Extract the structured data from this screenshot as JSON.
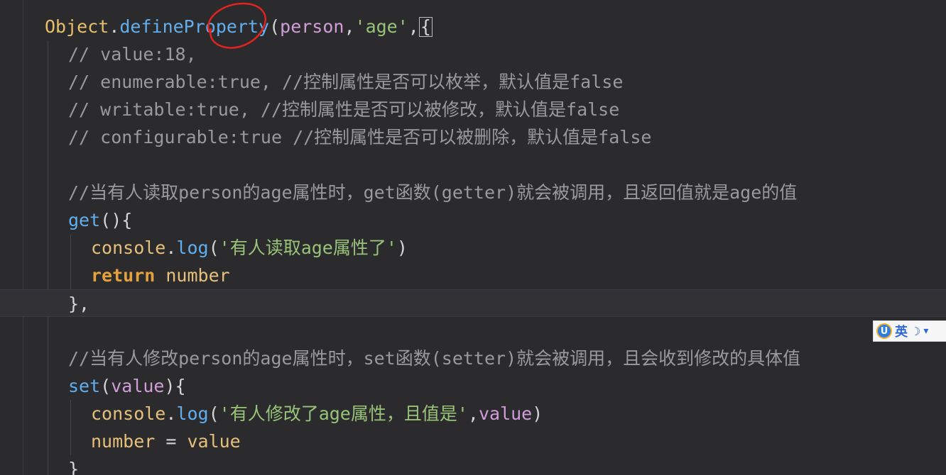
{
  "editor": {
    "lines": [
      {
        "id": "line-define-property",
        "tokens": [
          {
            "cls": "t-obj",
            "text": "Object"
          },
          {
            "cls": "t-punc",
            "text": "."
          },
          {
            "cls": "t-fn",
            "text": "defineProperty"
          },
          {
            "cls": "t-punc",
            "text": "("
          },
          {
            "cls": "t-param",
            "text": "person"
          },
          {
            "cls": "t-punc",
            "text": ","
          },
          {
            "cls": "t-str",
            "text": "'age'"
          },
          {
            "cls": "t-punc",
            "text": ","
          },
          {
            "cls": "t-punc",
            "text": "{",
            "boxed": true
          }
        ]
      },
      {
        "id": "line-comment-value",
        "tokens": [
          {
            "cls": "t-cmt",
            "text": "// value:18,"
          }
        ]
      },
      {
        "id": "line-comment-enumerable",
        "tokens": [
          {
            "cls": "t-cmt",
            "text": "// enumerable:true, //控制属性是否可以枚举，默认值是false"
          }
        ]
      },
      {
        "id": "line-comment-writable",
        "tokens": [
          {
            "cls": "t-cmt",
            "text": "// writable:true, //控制属性是否可以被修改，默认值是false"
          }
        ]
      },
      {
        "id": "line-comment-configurable",
        "tokens": [
          {
            "cls": "t-cmt",
            "text": "// configurable:true //控制属性是否可以被删除，默认值是false"
          }
        ]
      },
      {
        "id": "line-blank-1",
        "tokens": []
      },
      {
        "id": "line-comment-getter",
        "tokens": [
          {
            "cls": "t-cmt",
            "text": "//当有人读取person的age属性时，get函数(getter)就会被调用，且返回值就是age的值"
          }
        ]
      },
      {
        "id": "line-get-decl",
        "tokens": [
          {
            "cls": "t-fn",
            "text": "get"
          },
          {
            "cls": "t-punc",
            "text": "(){"
          }
        ]
      },
      {
        "id": "line-get-log",
        "tokens": [
          {
            "cls": "t-gold",
            "text": "console"
          },
          {
            "cls": "t-punc",
            "text": "."
          },
          {
            "cls": "t-call",
            "text": "log"
          },
          {
            "cls": "t-punc",
            "text": "("
          },
          {
            "cls": "t-str",
            "text": "'有人读取age属性了'"
          },
          {
            "cls": "t-punc",
            "text": ")"
          }
        ]
      },
      {
        "id": "line-get-return",
        "tokens": [
          {
            "cls": "t-kw",
            "text": "return"
          },
          {
            "cls": "t-punc",
            "text": " "
          },
          {
            "cls": "t-var",
            "text": "number"
          }
        ]
      },
      {
        "id": "line-get-close",
        "tokens": [
          {
            "cls": "t-punc",
            "text": "},"
          }
        ]
      },
      {
        "id": "line-blank-2",
        "tokens": []
      },
      {
        "id": "line-comment-setter",
        "tokens": [
          {
            "cls": "t-cmt",
            "text": "//当有人修改person的age属性时，set函数(setter)就会被调用，且会收到修改的具体值"
          }
        ]
      },
      {
        "id": "line-set-decl",
        "tokens": [
          {
            "cls": "t-fn",
            "text": "set"
          },
          {
            "cls": "t-punc",
            "text": "("
          },
          {
            "cls": "t-param",
            "text": "value"
          },
          {
            "cls": "t-punc",
            "text": "){"
          }
        ]
      },
      {
        "id": "line-set-log",
        "tokens": [
          {
            "cls": "t-gold",
            "text": "console"
          },
          {
            "cls": "t-punc",
            "text": "."
          },
          {
            "cls": "t-call",
            "text": "log"
          },
          {
            "cls": "t-punc",
            "text": "("
          },
          {
            "cls": "t-str",
            "text": "'有人修改了age属性，且值是'"
          },
          {
            "cls": "t-punc",
            "text": ","
          },
          {
            "cls": "t-param",
            "text": "value"
          },
          {
            "cls": "t-punc",
            "text": ")"
          }
        ]
      },
      {
        "id": "line-set-assign",
        "tokens": [
          {
            "cls": "t-var",
            "text": "number"
          },
          {
            "cls": "t-punc",
            "text": " = "
          },
          {
            "cls": "t-var",
            "text": "value"
          }
        ]
      },
      {
        "id": "line-set-close",
        "tokens": [
          {
            "cls": "t-punc",
            "text": "}"
          }
        ]
      }
    ]
  },
  "ime": {
    "lang": "英",
    "logo": "U",
    "moon_icon": "☽",
    "more_icon": "▾"
  },
  "colors": {
    "background": "#2b2b2e",
    "annotation": "#e0241f"
  }
}
